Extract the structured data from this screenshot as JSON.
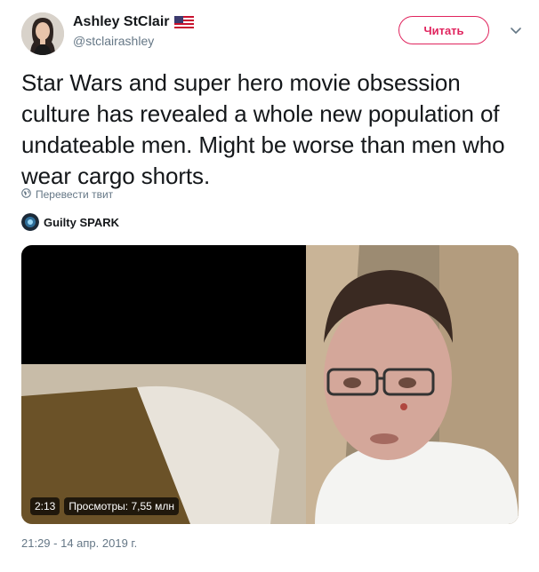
{
  "author": {
    "display_name": "Ashley StClair",
    "handle": "@stclairashley",
    "flag_icon": "us-flag-icon"
  },
  "follow_button": {
    "label": "Читать",
    "color": "#e0245e"
  },
  "tweet": {
    "text": "Star Wars and super hero movie obsession culture has revealed a whole new population of undateable men. Might be worse than men who wear cargo shorts.",
    "translate_label": "Перевести твит"
  },
  "source": {
    "name": "Guilty SPARK"
  },
  "video": {
    "duration": "2:13",
    "views": "Просмотры: 7,55 млн"
  },
  "timestamp": "21:29 - 14 апр. 2019 г.",
  "colors": {
    "text": "#14171a",
    "muted": "#657786",
    "accent": "#e0245e"
  }
}
